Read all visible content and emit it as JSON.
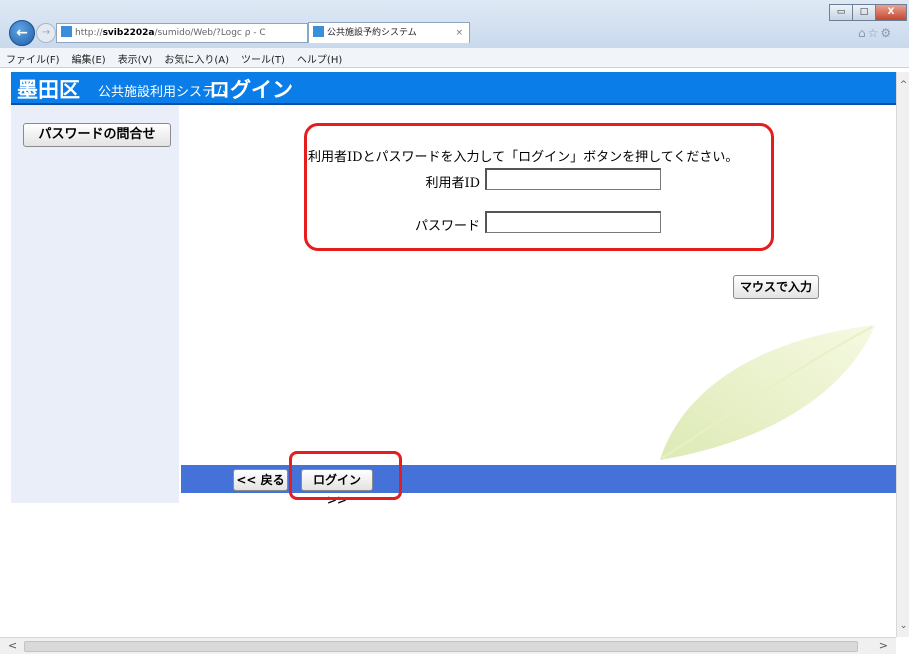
{
  "browser": {
    "address": {
      "prefix": "http://",
      "host": "svib2202a",
      "path": "/sumido/Web/?Logc",
      "controls": "ρ - C"
    },
    "tab": {
      "title": "公共施設予約システム",
      "close": "×"
    },
    "menu": [
      "ファイル(F)",
      "編集(E)",
      "表示(V)",
      "お気に入り(A)",
      "ツール(T)",
      "ヘルプ(H)"
    ],
    "window_controls": {
      "minimize": "▭",
      "maximize": "□",
      "close": "X"
    },
    "toolbar_icons": "⌂☆⚙"
  },
  "header": {
    "ward": "墨田区",
    "system": "公共施設利用システム",
    "login": "ログイン"
  },
  "sidebar": {
    "password_inquiry_button": "パスワードの問合せ"
  },
  "form": {
    "instruction": "利用者IDとパスワードを入力して「ログイン」ボタンを押してください。",
    "userid_label": "利用者ID",
    "userid_value": "",
    "password_label": "パスワード",
    "password_value": "",
    "mouse_input_button": "マウスで入力"
  },
  "footer": {
    "back_button": "<< 戻る",
    "login_button": "ログイン >>"
  },
  "colors": {
    "header_blue": "#0a7de8",
    "bottom_bar": "#4472d8",
    "highlight": "#e51d1d",
    "sidebar": "#e9eef8"
  }
}
